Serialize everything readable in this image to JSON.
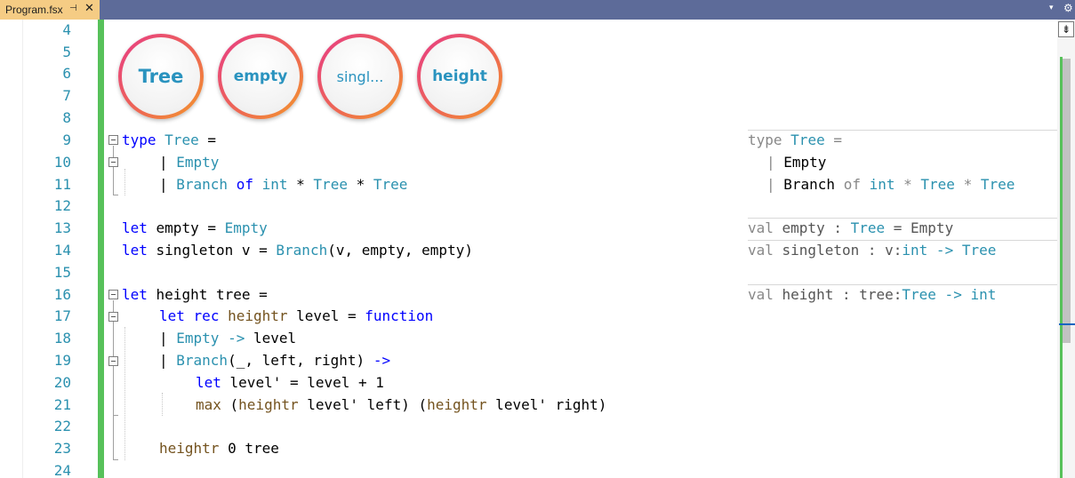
{
  "tab": {
    "title": "Program.fsx",
    "pin_glyph": "⊣",
    "close_glyph": "✕"
  },
  "tabbar": {
    "dropdown_glyph": "▾",
    "settings_glyph": "⚙"
  },
  "badges": [
    {
      "label": "Tree"
    },
    {
      "label": "empty"
    },
    {
      "label": "singl..."
    },
    {
      "label": "height"
    }
  ],
  "line_numbers": [
    "4",
    "5",
    "6",
    "7",
    "8",
    "9",
    "10",
    "11",
    "12",
    "13",
    "14",
    "15",
    "16",
    "17",
    "18",
    "19",
    "20",
    "21",
    "22",
    "23",
    "24"
  ],
  "code": {
    "l9": {
      "kw1": "type",
      "ty1": "Tree",
      "rest": " ="
    },
    "l10": {
      "bar": "| ",
      "ty1": "Empty"
    },
    "l11": {
      "bar": "| ",
      "ty1": "Branch",
      "kw1": "of",
      "ty2": "int",
      "star1": " * ",
      "ty3": "Tree",
      "star2": " * ",
      "ty4": "Tree"
    },
    "l13": {
      "kw1": "let",
      "name": " empty = ",
      "ty1": "Empty"
    },
    "l14": {
      "kw1": "let",
      "name": " singleton v = ",
      "ty1": "Branch",
      "rest": "(v, empty, empty)"
    },
    "l16": {
      "kw1": "let",
      "name": " height tree ="
    },
    "l17": {
      "kw1": "let",
      "kw2": "rec",
      "fn1": "heightr",
      "mid": " level = ",
      "kw3": "function"
    },
    "l18": {
      "bar": "| ",
      "ty1": "Empty",
      "kw1": " ->",
      "rest": " level"
    },
    "l19": {
      "bar": "| ",
      "ty1": "Branch",
      "rest": "(_, left, right) ",
      "kw1": "->"
    },
    "l20": {
      "kw1": "let",
      "rest": " level' = level + 1"
    },
    "l21": {
      "fn1": "max",
      "p1": " (",
      "fn2": "heightr",
      "r1": " level' left) (",
      "fn3": "heightr",
      "r2": " level' right)"
    },
    "l23": {
      "fn1": "heightr",
      "rest": " 0 tree"
    }
  },
  "signatures": {
    "s9": {
      "kw": "type ",
      "ty": "Tree",
      "rest": " ="
    },
    "s10": {
      "bar": "| ",
      "dk": "Empty"
    },
    "s11": {
      "bar": "| ",
      "dk": "Branch",
      "of": " of ",
      "ty1": "int",
      "star1": " * ",
      "ty2": "Tree",
      "star2": " * ",
      "ty3": "Tree"
    },
    "s13": {
      "val": "val ",
      "name": "empty : ",
      "ty1": "Tree",
      "eq": " = ",
      "val2": "Empty"
    },
    "s14": {
      "val": "val ",
      "name": "singleton : v:",
      "ty1": "int",
      "arrow": " -> ",
      "ty2": "Tree"
    },
    "s16": {
      "val": "val ",
      "name": "height : tree:",
      "ty1": "Tree",
      "arrow": " -> ",
      "ty2": "int"
    }
  },
  "scrollbar": {
    "split_glyph": "⇟"
  },
  "colors": {
    "tabbar": "#5d6b99",
    "tab_active": "#f5cc84",
    "keyword": "#0000ff",
    "type": "#2b91af",
    "function": "#74531f",
    "change_bar": "#57c15a",
    "badge_text": "#2a93bf"
  }
}
